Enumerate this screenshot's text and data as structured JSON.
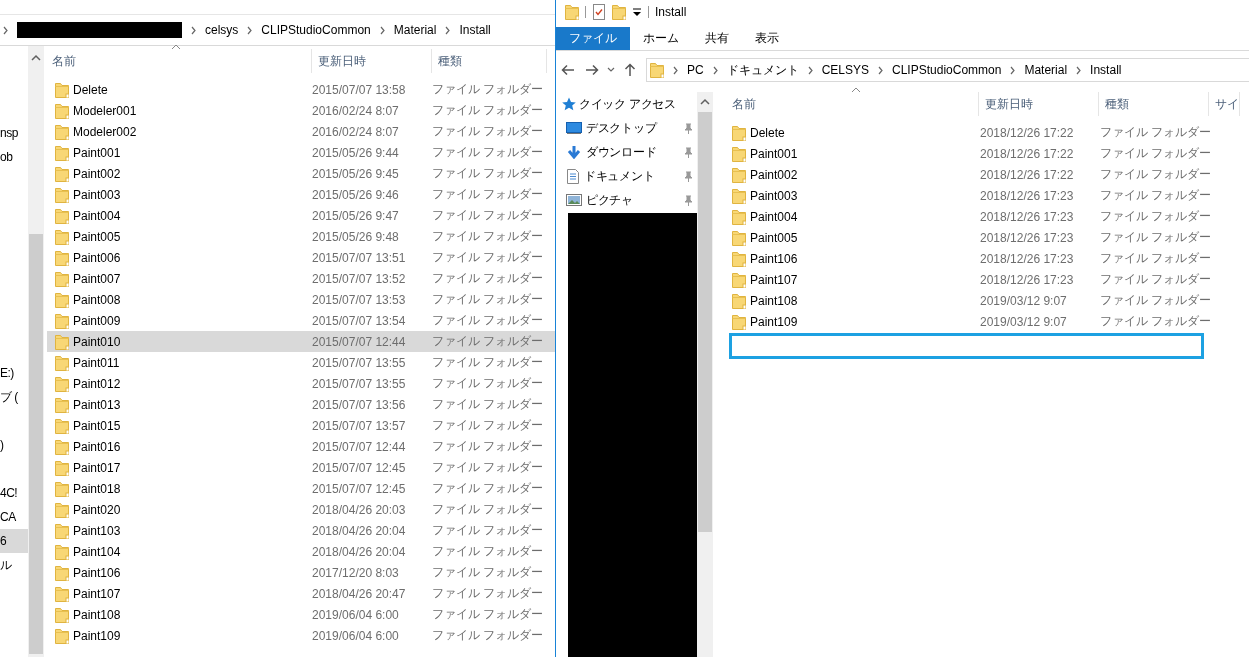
{
  "left_window": {
    "address": {
      "crumbs": [
        "celsys",
        "CLIPStudioCommon",
        "Material",
        "Install"
      ]
    },
    "nav_items": [
      {
        "label": "nsp",
        "selected": false
      },
      {
        "label": "ob",
        "selected": false
      },
      {
        "label": "E:)",
        "selected": false
      },
      {
        "label": "ブ (",
        "selected": false
      },
      {
        "label": ")",
        "selected": false
      },
      {
        "label": "4C!",
        "selected": false
      },
      {
        "label": "CA",
        "selected": false
      },
      {
        "label": "6",
        "selected": true
      },
      {
        "label": "ル",
        "selected": false
      }
    ],
    "columns": [
      "名前",
      "更新日時",
      "種類"
    ],
    "rows": [
      {
        "name": "Delete",
        "modified": "2015/07/07 13:58",
        "type": "ファイル フォルダー",
        "selected": false
      },
      {
        "name": "Modeler001",
        "modified": "2016/02/24 8:07",
        "type": "ファイル フォルダー",
        "selected": false
      },
      {
        "name": "Modeler002",
        "modified": "2016/02/24 8:07",
        "type": "ファイル フォルダー",
        "selected": false
      },
      {
        "name": "Paint001",
        "modified": "2015/05/26 9:44",
        "type": "ファイル フォルダー",
        "selected": false
      },
      {
        "name": "Paint002",
        "modified": "2015/05/26 9:45",
        "type": "ファイル フォルダー",
        "selected": false
      },
      {
        "name": "Paint003",
        "modified": "2015/05/26 9:46",
        "type": "ファイル フォルダー",
        "selected": false
      },
      {
        "name": "Paint004",
        "modified": "2015/05/26 9:47",
        "type": "ファイル フォルダー",
        "selected": false
      },
      {
        "name": "Paint005",
        "modified": "2015/05/26 9:48",
        "type": "ファイル フォルダー",
        "selected": false
      },
      {
        "name": "Paint006",
        "modified": "2015/07/07 13:51",
        "type": "ファイル フォルダー",
        "selected": false
      },
      {
        "name": "Paint007",
        "modified": "2015/07/07 13:52",
        "type": "ファイル フォルダー",
        "selected": false
      },
      {
        "name": "Paint008",
        "modified": "2015/07/07 13:53",
        "type": "ファイル フォルダー",
        "selected": false
      },
      {
        "name": "Paint009",
        "modified": "2015/07/07 13:54",
        "type": "ファイル フォルダー",
        "selected": false
      },
      {
        "name": "Paint010",
        "modified": "2015/07/07 12:44",
        "type": "ファイル フォルダー",
        "selected": true
      },
      {
        "name": "Paint011",
        "modified": "2015/07/07 13:55",
        "type": "ファイル フォルダー",
        "selected": false
      },
      {
        "name": "Paint012",
        "modified": "2015/07/07 13:55",
        "type": "ファイル フォルダー",
        "selected": false
      },
      {
        "name": "Paint013",
        "modified": "2015/07/07 13:56",
        "type": "ファイル フォルダー",
        "selected": false
      },
      {
        "name": "Paint015",
        "modified": "2015/07/07 13:57",
        "type": "ファイル フォルダー",
        "selected": false
      },
      {
        "name": "Paint016",
        "modified": "2015/07/07 12:44",
        "type": "ファイル フォルダー",
        "selected": false
      },
      {
        "name": "Paint017",
        "modified": "2015/07/07 12:45",
        "type": "ファイル フォルダー",
        "selected": false
      },
      {
        "name": "Paint018",
        "modified": "2015/07/07 12:45",
        "type": "ファイル フォルダー",
        "selected": false
      },
      {
        "name": "Paint020",
        "modified": "2018/04/26 20:03",
        "type": "ファイル フォルダー",
        "selected": false
      },
      {
        "name": "Paint103",
        "modified": "2018/04/26 20:04",
        "type": "ファイル フォルダー",
        "selected": false
      },
      {
        "name": "Paint104",
        "modified": "2018/04/26 20:04",
        "type": "ファイル フォルダー",
        "selected": false
      },
      {
        "name": "Paint106",
        "modified": "2017/12/20 8:03",
        "type": "ファイル フォルダー",
        "selected": false
      },
      {
        "name": "Paint107",
        "modified": "2018/04/26 20:47",
        "type": "ファイル フォルダー",
        "selected": false
      },
      {
        "name": "Paint108",
        "modified": "2019/06/04 6:00",
        "type": "ファイル フォルダー",
        "selected": false
      },
      {
        "name": "Paint109",
        "modified": "2019/06/04 6:00",
        "type": "ファイル フォルダー",
        "selected": false
      }
    ]
  },
  "right_window": {
    "title": "Install",
    "ribbon_tabs": [
      {
        "label": "ファイル",
        "selected": true
      },
      {
        "label": "ホーム",
        "selected": false
      },
      {
        "label": "共有",
        "selected": false
      },
      {
        "label": "表示",
        "selected": false
      }
    ],
    "address": {
      "crumbs": [
        "PC",
        "ドキュメント",
        "CELSYS",
        "CLIPStudioCommon",
        "Material",
        "Install"
      ]
    },
    "quick_access": {
      "label": "クイック アクセス",
      "items": [
        {
          "label": "デスクトップ",
          "kind": "desktop"
        },
        {
          "label": "ダウンロード",
          "kind": "download"
        },
        {
          "label": "ドキュメント",
          "kind": "document"
        },
        {
          "label": "ピクチャ",
          "kind": "picture"
        }
      ]
    },
    "columns": [
      "名前",
      "更新日時",
      "種類",
      "サイ"
    ],
    "rows": [
      {
        "name": "Delete",
        "modified": "2018/12/26 17:22",
        "type": "ファイル フォルダー",
        "selected": false
      },
      {
        "name": "Paint001",
        "modified": "2018/12/26 17:22",
        "type": "ファイル フォルダー",
        "selected": false
      },
      {
        "name": "Paint002",
        "modified": "2018/12/26 17:22",
        "type": "ファイル フォルダー",
        "selected": false
      },
      {
        "name": "Paint003",
        "modified": "2018/12/26 17:23",
        "type": "ファイル フォルダー",
        "selected": false
      },
      {
        "name": "Paint004",
        "modified": "2018/12/26 17:23",
        "type": "ファイル フォルダー",
        "selected": false
      },
      {
        "name": "Paint005",
        "modified": "2018/12/26 17:23",
        "type": "ファイル フォルダー",
        "selected": false
      },
      {
        "name": "Paint106",
        "modified": "2018/12/26 17:23",
        "type": "ファイル フォルダー",
        "selected": false
      },
      {
        "name": "Paint107",
        "modified": "2018/12/26 17:23",
        "type": "ファイル フォルダー",
        "selected": false
      },
      {
        "name": "Paint108",
        "modified": "2019/03/12 9:07",
        "type": "ファイル フォルダー",
        "selected": false
      },
      {
        "name": "Paint109",
        "modified": "2019/03/12 9:07",
        "type": "ファイル フォルダー",
        "selected": false
      }
    ],
    "rename_field": {
      "active": true
    }
  }
}
